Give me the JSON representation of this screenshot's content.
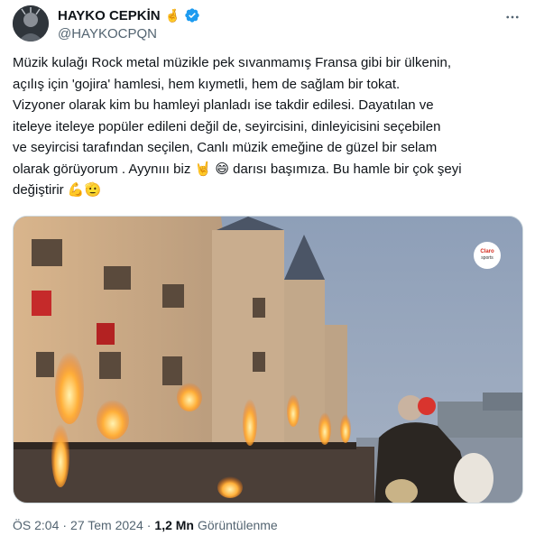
{
  "author": {
    "name": "HAYKO CEPKİN",
    "name_emoji": "🤞",
    "handle": "@HAYKOCPQN"
  },
  "tweet": {
    "text": "Müzik kulağı Rock metal müzikle pek sıvanmamış Fransa gibi bir ülkenin,\naçılış için 'gojira' hamlesi, hem kıymetli, hem de sağlam bir tokat.\nVizyoner olarak kim bu hamleyi planladı ise takdir edilesi. Dayatılan ve\niteleye iteleye popüler edileni değil de, seyircisini, dinleyicisini seçebilen\nve seyircisi tarafından seçilen, Canlı müzik emeğine de güzel bir selam\nolarak görüyorum . Ayynııı biz",
    "emoji_1": "🤘",
    "emoji_2": "😄",
    "text_2": " darısı başımıza. Bu hamle bir çok şeyi\ndeğiştirir ",
    "emoji_3": "💪",
    "emoji_4": "🫡"
  },
  "media": {
    "watermark_brand": "Claro",
    "watermark_sub": "sports"
  },
  "meta": {
    "time": "ÖS 2:04",
    "date": "27 Tem 2024",
    "views_count": "1,2 Mn",
    "views_label": "Görüntülenme"
  },
  "colors": {
    "verified": "#1d9bf0",
    "secondary_text": "#536471",
    "primary_text": "#0f1419"
  }
}
